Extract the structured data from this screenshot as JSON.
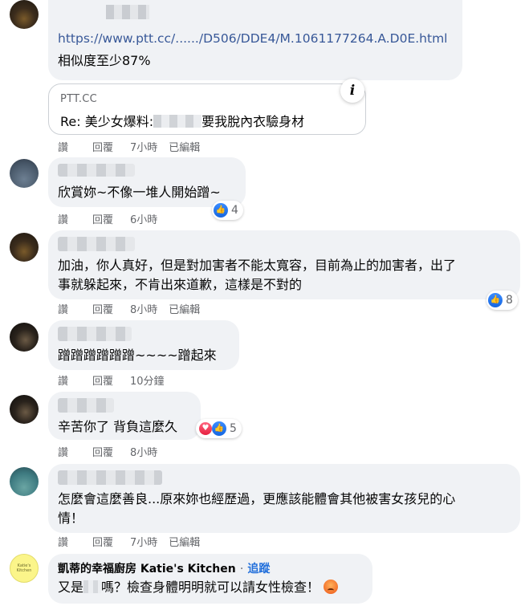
{
  "actions": {
    "like": "讚",
    "reply": "回覆",
    "edited": "已編輯"
  },
  "comments": [
    {
      "link": "https://www.ptt.cc/....../D506/DDE4/M.1061177264.A.D0E.html",
      "text": "相似度至少87%",
      "preview": {
        "domain": "PTT.CC",
        "title_start": "Re: 美少女爆料:",
        "title_end": "要我脫內衣驗身材",
        "info_icon": "i"
      },
      "time": "7小時",
      "edited": true
    },
    {
      "text": "欣賞妳~不像一堆人開始蹭~",
      "time": "6小時",
      "reaction_count": "4",
      "reactions": [
        "like-icon"
      ]
    },
    {
      "text_line1": "加油，你人真好，但是對加害者不能太寬容，目前為止的加害者，出了",
      "text_line2": "事就躲起來，不肯出來道歉，這樣是不對的",
      "time": "8小時",
      "edited": true,
      "reaction_count": "8",
      "reactions": [
        "like-icon"
      ]
    },
    {
      "text": "蹭蹭蹭蹭蹭蹭~~~~蹭起來",
      "time": "10分鐘"
    },
    {
      "text": "辛苦你了 背負這麼久",
      "time": "8小時",
      "reaction_count": "5",
      "reactions": [
        "love-icon",
        "like-icon"
      ]
    },
    {
      "text_line1": "怎麼會這麼善良...原來妳也經歷過，更應該能體會其他被害女孩兒的心",
      "text_line2": "情！",
      "time": "7小時",
      "edited": true
    },
    {
      "author": "凱蒂的幸福廚房 Katie's Kitchen",
      "author_sep": "·",
      "follow": "追蹤",
      "avatar_text": "Katie's Kitchen",
      "text_start": "又是",
      "text_end": "嗎？檢查身體明明就可以請女性檢查！",
      "emoji": "angry-face-icon"
    }
  ]
}
